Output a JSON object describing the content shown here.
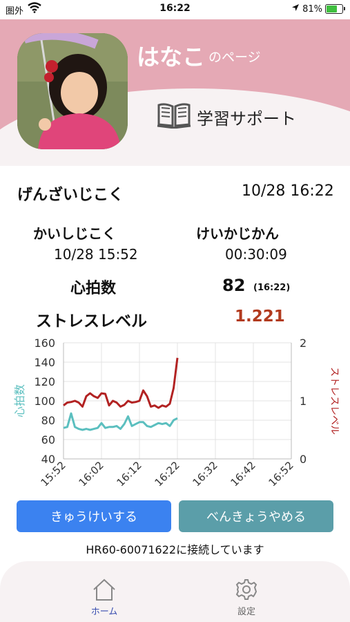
{
  "status_bar": {
    "carrier": "圏外",
    "time": "16:22",
    "battery": "81%",
    "battery_level": 0.81
  },
  "header": {
    "name": "はなこ",
    "suffix": "のページ",
    "study_label": "学習サポート"
  },
  "info": {
    "current_time_label": "げんざいじこく",
    "current_time_value": "10/28 16:22",
    "start_label": "かいしじこく",
    "start_value": "10/28 15:52",
    "elapsed_label": "けいかじかん",
    "elapsed_value": "00:30:09",
    "hr_label": "心拍数",
    "hr_value": "82",
    "hr_time": "(16:22)",
    "stress_label": "ストレスレベル",
    "stress_value": "1.221",
    "stress_color": "#b23a1e"
  },
  "chart_data": {
    "type": "line",
    "x_ticks": [
      "15:52",
      "16:02",
      "16:12",
      "16:22",
      "16:32",
      "16:42",
      "16:52"
    ],
    "xlim": [
      "15:52",
      "16:52"
    ],
    "ylabel_left": "心拍数",
    "ylabel_right": "ストレスレベル",
    "ylim_left": [
      40,
      160
    ],
    "yticks_left": [
      40,
      60,
      80,
      100,
      120,
      140,
      160
    ],
    "ylim_right": [
      0,
      2
    ],
    "yticks_right": [
      0,
      1,
      2
    ],
    "grid": true,
    "series": [
      {
        "name": "心拍数",
        "axis": "left",
        "color": "#5bbfbf",
        "x": [
          "15:52",
          "15:53",
          "15:54",
          "15:55",
          "15:56",
          "15:57",
          "15:58",
          "15:59",
          "16:00",
          "16:01",
          "16:02",
          "16:03",
          "16:04",
          "16:05",
          "16:06",
          "16:07",
          "16:08",
          "16:09",
          "16:10",
          "16:11",
          "16:12",
          "16:13",
          "16:14",
          "16:15",
          "16:16",
          "16:17",
          "16:18",
          "16:19",
          "16:20",
          "16:21",
          "16:22"
        ],
        "values": [
          72,
          73,
          87,
          73,
          71,
          70,
          71,
          70,
          71,
          72,
          77,
          72,
          73,
          73,
          74,
          71,
          76,
          84,
          74,
          76,
          78,
          78,
          74,
          73,
          75,
          77,
          76,
          77,
          74,
          80,
          82
        ]
      },
      {
        "name": "ストレスレベル",
        "axis": "right",
        "color": "#b22222",
        "x": [
          "15:52",
          "15:53",
          "15:54",
          "15:55",
          "15:56",
          "15:57",
          "15:58",
          "15:59",
          "16:00",
          "16:01",
          "16:02",
          "16:03",
          "16:04",
          "16:05",
          "16:06",
          "16:07",
          "16:08",
          "16:09",
          "16:10",
          "16:11",
          "16:12",
          "16:13",
          "16:14",
          "16:15",
          "16:16",
          "16:17",
          "16:18",
          "16:19",
          "16:20",
          "16:21",
          "16:22"
        ],
        "values": [
          0.92,
          0.97,
          0.98,
          1.0,
          0.97,
          0.9,
          1.08,
          1.13,
          1.08,
          1.05,
          1.13,
          1.12,
          0.92,
          1.0,
          0.97,
          0.9,
          0.93,
          1.0,
          0.97,
          0.98,
          1.0,
          1.18,
          1.08,
          0.9,
          0.92,
          0.88,
          0.92,
          0.9,
          0.95,
          1.22,
          1.74
        ]
      }
    ]
  },
  "buttons": {
    "break_label": "きゅうけいする",
    "stop_label": "べんきょうやめる"
  },
  "connection_text": "HR60-60071622に接続しています",
  "tabbar": {
    "home_label": "ホーム",
    "settings_label": "設定",
    "active_color": "#3a4fb0"
  }
}
